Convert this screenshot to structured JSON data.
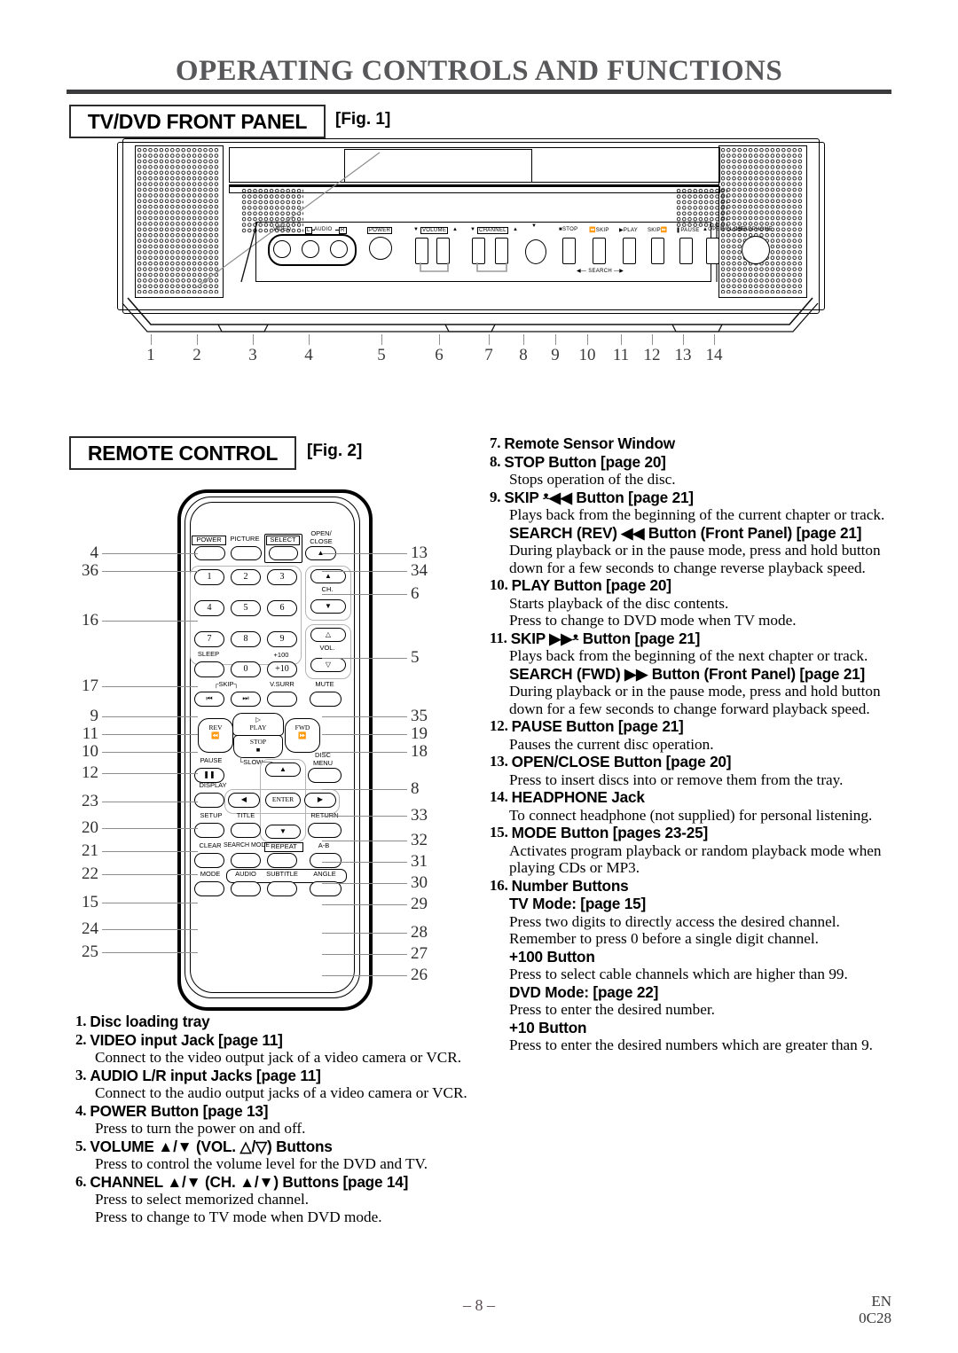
{
  "document": {
    "title": "OPERATING CONTROLS AND FUNCTIONS",
    "page_number": "– 8 –",
    "language_code": "EN",
    "doc_code": "0C28"
  },
  "sections": {
    "front_panel": {
      "label": "TV/DVD FRONT PANEL",
      "figure": "[Fig. 1]"
    },
    "remote": {
      "label": "REMOTE CONTROL",
      "figure": "[Fig. 2]"
    }
  },
  "front_panel_diagram": {
    "labels": {
      "video": "VIDEO",
      "audio": "AUDIO",
      "audio_left": "L",
      "audio_right": "R",
      "power": "POWER",
      "volume": "VOLUME",
      "channel": "CHANNEL",
      "stop": "STOP",
      "skip_back": "SKIP",
      "play": "PLAY",
      "skip_fwd": "SKIP",
      "pause": "PAUSE",
      "open_close": "OPEN/CLOSE",
      "headphone": "HEADPHONE",
      "search": "SEARCH"
    },
    "callouts": [
      "1",
      "2",
      "3",
      "4",
      "5",
      "6",
      "7",
      "8",
      "9",
      "10",
      "11",
      "12",
      "13",
      "14"
    ]
  },
  "remote_diagram": {
    "buttons": {
      "power": "POWER",
      "picture": "PICTURE",
      "select": "SELECT",
      "open_close": "OPEN/\nCLOSE",
      "num1": "1",
      "num2": "2",
      "num3": "3",
      "num4": "4",
      "num5": "5",
      "num6": "6",
      "num7": "7",
      "num8": "8",
      "num9": "9",
      "num0": "0",
      "sleep": "SLEEP",
      "plus100": "+100",
      "plus10": "+10",
      "ch": "CH.",
      "vol": "VOL.",
      "skip": "SKIP",
      "vsurr": "V.SURR",
      "mute": "MUTE",
      "play": "PLAY",
      "rev": "REV",
      "fwd": "FWD",
      "stop": "STOP",
      "pause": "PAUSE",
      "slow": "SLOW",
      "disc_menu": "DISC\nMENU",
      "display": "DISPLAY",
      "enter": "ENTER",
      "setup": "SETUP",
      "title": "TITLE",
      "return": "RETURN",
      "clear": "CLEAR",
      "search_mode": "SEARCH MODE",
      "repeat": "REPEAT",
      "ab": "A-B",
      "mode": "MODE",
      "audio": "AUDIO",
      "subtitle": "SUBTITLE",
      "angle": "ANGLE"
    },
    "callouts_left": [
      "4",
      "36",
      "16",
      "17",
      "9",
      "11",
      "10",
      "12",
      "23",
      "20",
      "21",
      "22",
      "15",
      "24",
      "25"
    ],
    "callouts_right": [
      "13",
      "34",
      "6",
      "5",
      "35",
      "19",
      "18",
      "8",
      "33",
      "32",
      "31",
      "30",
      "29",
      "28",
      "27",
      "26"
    ]
  },
  "left_column": [
    {
      "num": "1.",
      "heading": "Disc loading tray",
      "body": []
    },
    {
      "num": "2.",
      "heading": "VIDEO input Jack [page 11]",
      "body": [
        "Connect to the video output jack of a video camera or VCR."
      ]
    },
    {
      "num": "3.",
      "heading": "AUDIO L/R input Jacks [page 11]",
      "body": [
        "Connect to the audio output jacks of a video camera or VCR."
      ]
    },
    {
      "num": "4.",
      "heading": "POWER Button [page 13]",
      "body": [
        "Press to turn the power on and off."
      ]
    },
    {
      "num": "5.",
      "heading": "VOLUME ▲/▼ (VOL. △/▽) Buttons",
      "body": [
        "Press to control the volume level for the DVD and TV."
      ]
    },
    {
      "num": "6.",
      "heading": "CHANNEL ▲/▼ (CH. ▲/▼) Buttons [page 14]",
      "body": [
        "Press to select memorized channel.",
        "Press to change to TV mode when DVD mode."
      ]
    }
  ],
  "right_column": [
    {
      "num": "7.",
      "heading": "Remote Sensor Window",
      "body": []
    },
    {
      "num": "8.",
      "heading": "STOP Button [page 20]",
      "body": [
        "Stops operation of the disc."
      ]
    },
    {
      "num": "9.",
      "heading": "SKIP ᵜ◀◀ Button [page 21]",
      "body": [
        "Plays back from the beginning of the current chapter or track."
      ],
      "sub": [
        {
          "heading": "SEARCH (REV) ◀◀ Button (Front Panel) [page 21]",
          "body": [
            "During playback or in the pause mode, press and hold button down for a few seconds to change reverse playback speed."
          ]
        }
      ]
    },
    {
      "num": "10.",
      "heading": "PLAY Button [page 20]",
      "body": [
        "Starts playback of the disc contents.",
        "Press to change to DVD mode when TV mode."
      ]
    },
    {
      "num": "11.",
      "heading": "SKIP ▶▶ᵜ Button [page 21]",
      "body": [
        "Plays back from the beginning of the next chapter or track."
      ],
      "sub": [
        {
          "heading": "SEARCH (FWD) ▶▶ Button (Front Panel) [page 21]",
          "body": [
            "During playback or in the pause mode, press and hold button down for a few seconds to change forward playback speed."
          ]
        }
      ]
    },
    {
      "num": "12.",
      "heading": "PAUSE Button [page 21]",
      "body": [
        "Pauses the current disc operation."
      ]
    },
    {
      "num": "13.",
      "heading": "OPEN/CLOSE Button [page 20]",
      "body": [
        "Press to insert discs into or remove them from the tray."
      ]
    },
    {
      "num": "14.",
      "heading": "HEADPHONE Jack",
      "body": [
        "To connect headphone (not supplied) for personal listening."
      ]
    },
    {
      "num": "15.",
      "heading": "MODE Button [pages 23-25]",
      "body": [
        "Activates program playback or random playback mode when playing CDs or MP3."
      ]
    },
    {
      "num": "16.",
      "heading": "Number Buttons",
      "body": [],
      "sub": [
        {
          "heading": "TV Mode: [page 15]",
          "body": [
            "Press two digits to directly access the desired channel.",
            "Remember to press 0 before a single digit channel."
          ]
        },
        {
          "heading": "+100 Button",
          "body": [
            "Press to select cable channels which are higher than 99."
          ]
        },
        {
          "heading": "DVD Mode: [page 22]",
          "body": [
            "Press to enter the desired number."
          ]
        },
        {
          "heading": "+10 Button",
          "body": [
            "Press to enter the desired numbers which are greater than 9."
          ]
        }
      ]
    }
  ]
}
